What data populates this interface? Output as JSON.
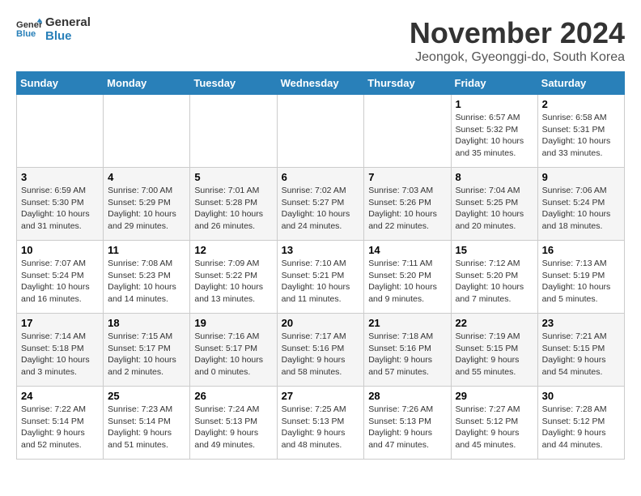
{
  "logo": {
    "line1": "General",
    "line2": "Blue"
  },
  "header": {
    "month": "November 2024",
    "location": "Jeongok, Gyeonggi-do, South Korea"
  },
  "weekdays": [
    "Sunday",
    "Monday",
    "Tuesday",
    "Wednesday",
    "Thursday",
    "Friday",
    "Saturday"
  ],
  "weeks": [
    [
      {
        "day": "",
        "info": ""
      },
      {
        "day": "",
        "info": ""
      },
      {
        "day": "",
        "info": ""
      },
      {
        "day": "",
        "info": ""
      },
      {
        "day": "",
        "info": ""
      },
      {
        "day": "1",
        "info": "Sunrise: 6:57 AM\nSunset: 5:32 PM\nDaylight: 10 hours\nand 35 minutes."
      },
      {
        "day": "2",
        "info": "Sunrise: 6:58 AM\nSunset: 5:31 PM\nDaylight: 10 hours\nand 33 minutes."
      }
    ],
    [
      {
        "day": "3",
        "info": "Sunrise: 6:59 AM\nSunset: 5:30 PM\nDaylight: 10 hours\nand 31 minutes."
      },
      {
        "day": "4",
        "info": "Sunrise: 7:00 AM\nSunset: 5:29 PM\nDaylight: 10 hours\nand 29 minutes."
      },
      {
        "day": "5",
        "info": "Sunrise: 7:01 AM\nSunset: 5:28 PM\nDaylight: 10 hours\nand 26 minutes."
      },
      {
        "day": "6",
        "info": "Sunrise: 7:02 AM\nSunset: 5:27 PM\nDaylight: 10 hours\nand 24 minutes."
      },
      {
        "day": "7",
        "info": "Sunrise: 7:03 AM\nSunset: 5:26 PM\nDaylight: 10 hours\nand 22 minutes."
      },
      {
        "day": "8",
        "info": "Sunrise: 7:04 AM\nSunset: 5:25 PM\nDaylight: 10 hours\nand 20 minutes."
      },
      {
        "day": "9",
        "info": "Sunrise: 7:06 AM\nSunset: 5:24 PM\nDaylight: 10 hours\nand 18 minutes."
      }
    ],
    [
      {
        "day": "10",
        "info": "Sunrise: 7:07 AM\nSunset: 5:24 PM\nDaylight: 10 hours\nand 16 minutes."
      },
      {
        "day": "11",
        "info": "Sunrise: 7:08 AM\nSunset: 5:23 PM\nDaylight: 10 hours\nand 14 minutes."
      },
      {
        "day": "12",
        "info": "Sunrise: 7:09 AM\nSunset: 5:22 PM\nDaylight: 10 hours\nand 13 minutes."
      },
      {
        "day": "13",
        "info": "Sunrise: 7:10 AM\nSunset: 5:21 PM\nDaylight: 10 hours\nand 11 minutes."
      },
      {
        "day": "14",
        "info": "Sunrise: 7:11 AM\nSunset: 5:20 PM\nDaylight: 10 hours\nand 9 minutes."
      },
      {
        "day": "15",
        "info": "Sunrise: 7:12 AM\nSunset: 5:20 PM\nDaylight: 10 hours\nand 7 minutes."
      },
      {
        "day": "16",
        "info": "Sunrise: 7:13 AM\nSunset: 5:19 PM\nDaylight: 10 hours\nand 5 minutes."
      }
    ],
    [
      {
        "day": "17",
        "info": "Sunrise: 7:14 AM\nSunset: 5:18 PM\nDaylight: 10 hours\nand 3 minutes."
      },
      {
        "day": "18",
        "info": "Sunrise: 7:15 AM\nSunset: 5:17 PM\nDaylight: 10 hours\nand 2 minutes."
      },
      {
        "day": "19",
        "info": "Sunrise: 7:16 AM\nSunset: 5:17 PM\nDaylight: 10 hours\nand 0 minutes."
      },
      {
        "day": "20",
        "info": "Sunrise: 7:17 AM\nSunset: 5:16 PM\nDaylight: 9 hours\nand 58 minutes."
      },
      {
        "day": "21",
        "info": "Sunrise: 7:18 AM\nSunset: 5:16 PM\nDaylight: 9 hours\nand 57 minutes."
      },
      {
        "day": "22",
        "info": "Sunrise: 7:19 AM\nSunset: 5:15 PM\nDaylight: 9 hours\nand 55 minutes."
      },
      {
        "day": "23",
        "info": "Sunrise: 7:21 AM\nSunset: 5:15 PM\nDaylight: 9 hours\nand 54 minutes."
      }
    ],
    [
      {
        "day": "24",
        "info": "Sunrise: 7:22 AM\nSunset: 5:14 PM\nDaylight: 9 hours\nand 52 minutes."
      },
      {
        "day": "25",
        "info": "Sunrise: 7:23 AM\nSunset: 5:14 PM\nDaylight: 9 hours\nand 51 minutes."
      },
      {
        "day": "26",
        "info": "Sunrise: 7:24 AM\nSunset: 5:13 PM\nDaylight: 9 hours\nand 49 minutes."
      },
      {
        "day": "27",
        "info": "Sunrise: 7:25 AM\nSunset: 5:13 PM\nDaylight: 9 hours\nand 48 minutes."
      },
      {
        "day": "28",
        "info": "Sunrise: 7:26 AM\nSunset: 5:13 PM\nDaylight: 9 hours\nand 47 minutes."
      },
      {
        "day": "29",
        "info": "Sunrise: 7:27 AM\nSunset: 5:12 PM\nDaylight: 9 hours\nand 45 minutes."
      },
      {
        "day": "30",
        "info": "Sunrise: 7:28 AM\nSunset: 5:12 PM\nDaylight: 9 hours\nand 44 minutes."
      }
    ]
  ]
}
